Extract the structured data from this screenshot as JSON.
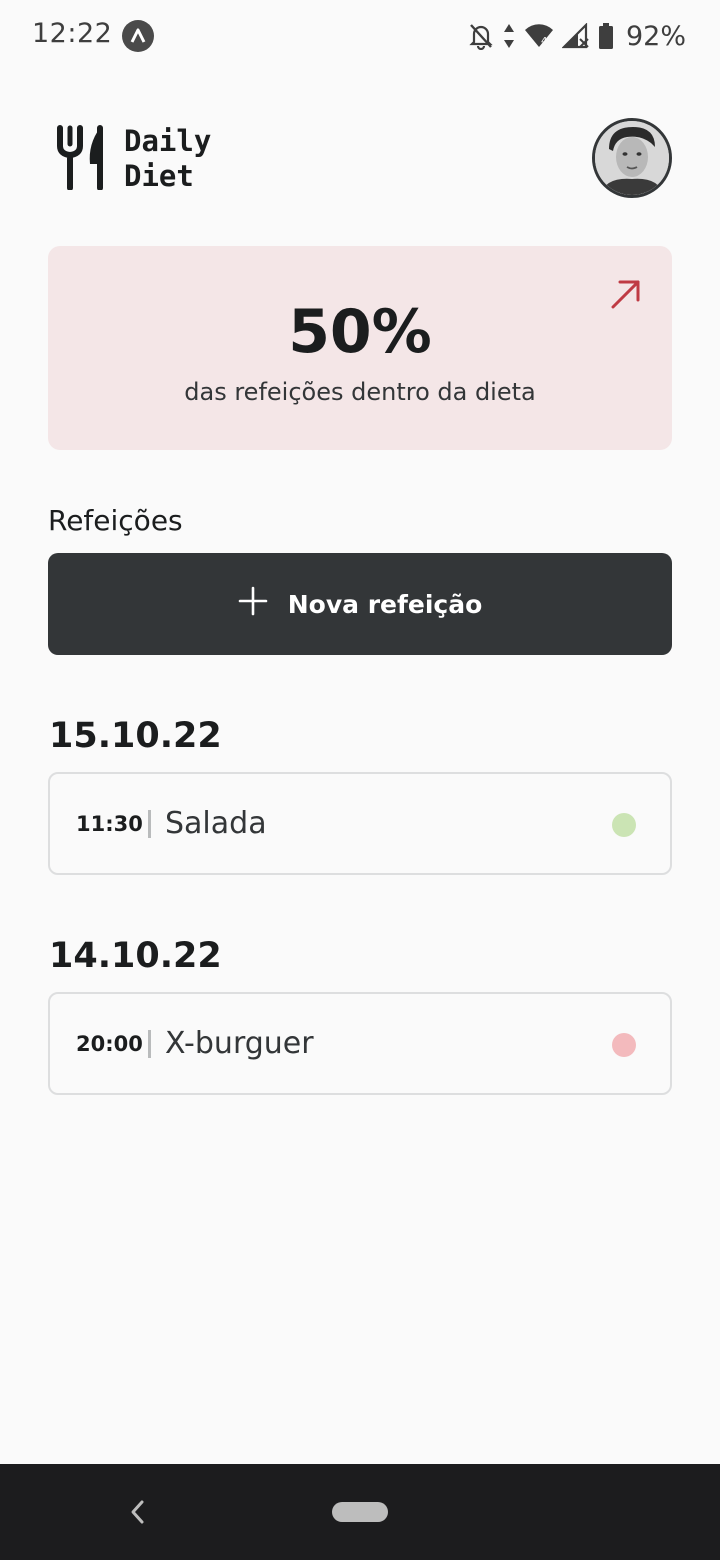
{
  "status_bar": {
    "time": "12:22",
    "battery": "92%",
    "icons": [
      "app-notification-icon",
      "bell-off-icon",
      "data-arrows-icon",
      "wifi-icon",
      "signal-icon",
      "battery-icon"
    ]
  },
  "header": {
    "logo_line1": "Daily",
    "logo_line2": "Diet",
    "logo_icon": "fork-knife-icon",
    "avatar_icon": "user-avatar"
  },
  "summary": {
    "percent": "50%",
    "label": "das refeições dentro da dieta",
    "arrow_icon": "arrow-up-right-icon",
    "accent_color": "#BF3B44",
    "background": "#F4E6E7"
  },
  "meals": {
    "section_label": "Refeições",
    "new_meal_label": "Nova refeição",
    "groups": [
      {
        "date": "15.10.22",
        "items": [
          {
            "time": "11:30",
            "name": "Salada",
            "status_color": "#CBE4B4"
          }
        ]
      },
      {
        "date": "14.10.22",
        "items": [
          {
            "time": "20:00",
            "name": "X-burguer",
            "status_color": "#F3BABD"
          }
        ]
      }
    ]
  },
  "nav": {
    "back_icon": "chevron-left-icon",
    "home_icon": "home-pill-icon"
  }
}
